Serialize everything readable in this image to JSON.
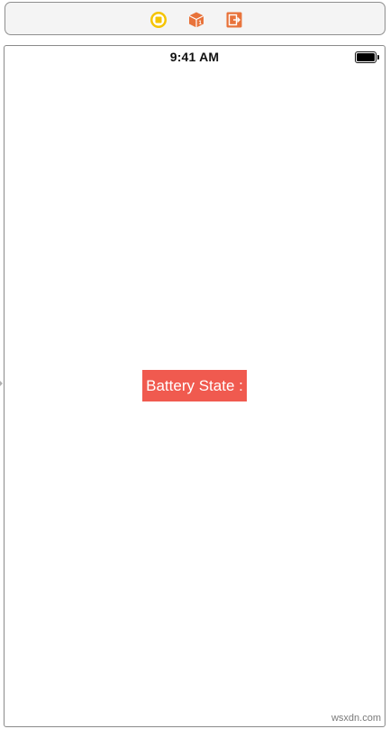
{
  "scene_dock": {
    "icons": [
      {
        "name": "view-controller-icon",
        "color": "#f5c400"
      },
      {
        "name": "first-responder-icon",
        "color": "#e8733b"
      },
      {
        "name": "exit-icon",
        "color": "#e8733b"
      }
    ]
  },
  "status_bar": {
    "time": "9:41 AM",
    "battery_level": 1.0
  },
  "main": {
    "battery_label": "Battery State :",
    "label_background": "#f05a4f",
    "label_text_color": "#ffffff"
  },
  "watermark": "wsxdn.com"
}
